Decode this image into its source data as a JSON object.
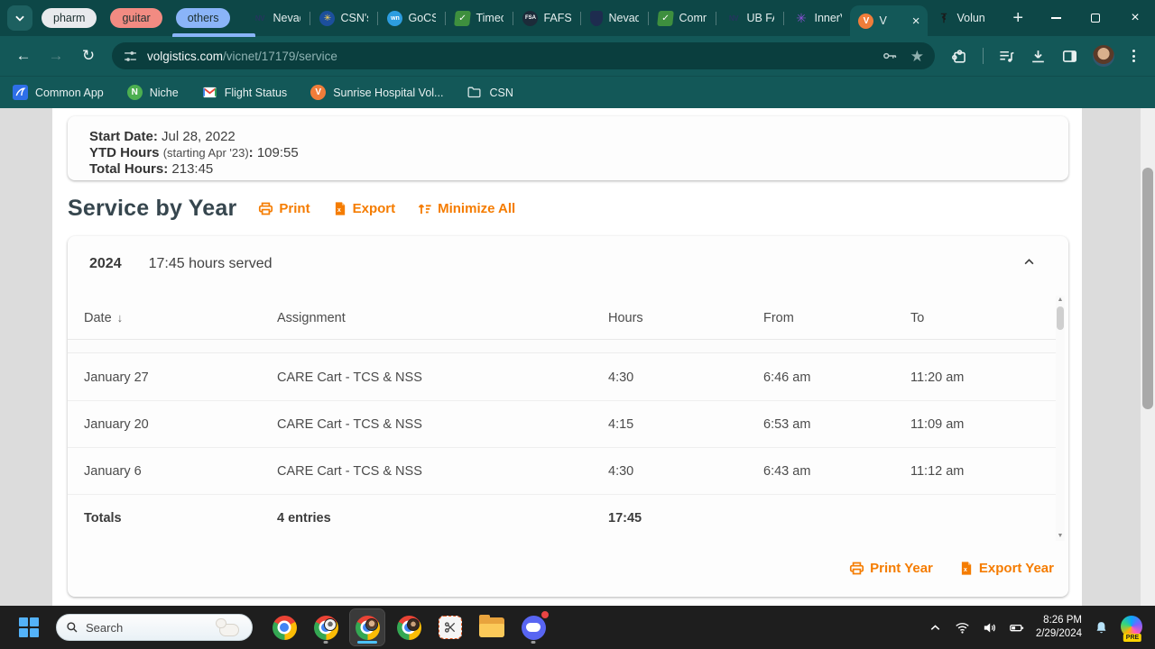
{
  "colors": {
    "accent_orange": "#F57C00",
    "chrome_teal": "#135858",
    "tabstrip_teal": "#0D4747",
    "group_pharm": "#E8EAED",
    "group_guitar": "#F28B82",
    "group_others": "#8AB4F8",
    "taskbar_active_underline": "#4CC2FF"
  },
  "browser": {
    "tab_groups": [
      {
        "label": "pharm",
        "color": "#E8EAED",
        "underlined": false
      },
      {
        "label": "guitar",
        "color": "#F28B82",
        "underlined": false
      },
      {
        "label": "others",
        "color": "#8AB4F8",
        "underlined": true
      }
    ],
    "tabs": [
      {
        "title": "Nevad",
        "icon": "nv-logo",
        "active": false
      },
      {
        "title": "CSN's",
        "icon": "csn-logo",
        "active": false
      },
      {
        "title": "GoCS",
        "icon": "gocsn-logo",
        "active": false
      },
      {
        "title": "Timec",
        "icon": "timecard-logo",
        "active": false
      },
      {
        "title": "FAFSA",
        "icon": "fafsa-logo",
        "active": false
      },
      {
        "title": "Nevad",
        "icon": "nevada-shield-logo",
        "active": false
      },
      {
        "title": "Comm",
        "icon": "timecard-logo",
        "active": false
      },
      {
        "title": "UB FA",
        "icon": "nv-logo",
        "active": false
      },
      {
        "title": "InnerV",
        "icon": "innerview-logo",
        "active": false
      },
      {
        "title": "V",
        "icon": "volgistics-logo",
        "active": true
      },
      {
        "title": "Volun",
        "icon": "medical-logo",
        "active": false
      }
    ],
    "url": {
      "domain": "volgistics.com",
      "path": "/vicnet/17179/service"
    },
    "bookmarks": [
      {
        "label": "Common App",
        "icon": "commonapp-logo"
      },
      {
        "label": "Niche",
        "icon": "niche-logo"
      },
      {
        "label": "Flight Status",
        "icon": "gmail-logo"
      },
      {
        "label": "Sunrise Hospital Vol...",
        "icon": "volgistics-logo"
      },
      {
        "label": "CSN",
        "icon": "folder-icon"
      }
    ]
  },
  "page": {
    "summary": {
      "start_label": "Start Date:",
      "start_value": "Jul 28, 2022",
      "ytd_label": "YTD Hours",
      "ytd_note": "(starting Apr '23)",
      "ytd_sep": ":",
      "ytd_value": "109:55",
      "total_label": "Total Hours:",
      "total_value": "213:45"
    },
    "section": {
      "title": "Service by Year",
      "print": "Print",
      "export": "Export",
      "minimize": "Minimize All"
    },
    "year_card": {
      "year": "2024",
      "served": "17:45 hours served",
      "columns": {
        "date": "Date",
        "sort_indicator": "↓",
        "assignment": "Assignment",
        "hours": "Hours",
        "from": "From",
        "to": "To"
      },
      "rows": [
        {
          "date": "January 27",
          "assignment": "CARE Cart - TCS & NSS",
          "hours": "4:30",
          "from": "6:46 am",
          "to": "11:20 am"
        },
        {
          "date": "January 20",
          "assignment": "CARE Cart - TCS & NSS",
          "hours": "4:15",
          "from": "6:53 am",
          "to": "11:09 am"
        },
        {
          "date": "January 6",
          "assignment": "CARE Cart - TCS & NSS",
          "hours": "4:30",
          "from": "6:43 am",
          "to": "11:12 am"
        }
      ],
      "totals": {
        "label": "Totals",
        "entries": "4 entries",
        "hours": "17:45"
      },
      "print_year": "Print Year",
      "export_year": "Export Year"
    }
  },
  "taskbar": {
    "search_placeholder": "Search",
    "apps": [
      {
        "name": "chrome",
        "running": false,
        "active": false
      },
      {
        "name": "chrome-profile2",
        "running": true,
        "active": false
      },
      {
        "name": "chrome-active",
        "running": true,
        "active": true
      },
      {
        "name": "chrome-profile3",
        "running": false,
        "active": false
      },
      {
        "name": "snipping-tool",
        "running": false,
        "active": false
      },
      {
        "name": "file-explorer",
        "running": false,
        "active": false
      },
      {
        "name": "discord",
        "running": true,
        "active": false,
        "notification": true
      }
    ],
    "time": "8:26 PM",
    "date": "2/29/2024",
    "copilot_badge": "PRE"
  }
}
